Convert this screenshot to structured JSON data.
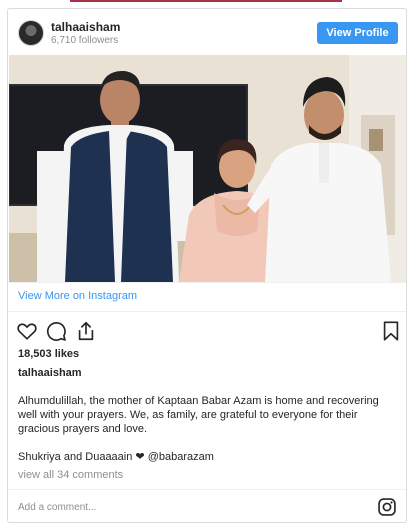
{
  "post": {
    "username": "talhaaisham",
    "followers": "6,710 followers",
    "view_profile": "View Profile",
    "view_more": "View More on Instagram",
    "likes": "18,503 likes",
    "caption_user": "talhaaisham",
    "caption": "Alhumdulillah, the mother of Kaptaan Babar Azam is home and recovering well with your prayers. We, as family, are grateful to everyone for their gracious prayers and love.",
    "caption_line2_text": "Shukriya and Duaaaain",
    "caption_line2_mention": "@babarazam",
    "view_comments": "view all 34 comments",
    "add_comment_placeholder": "Add a comment..."
  },
  "icons": {
    "like": "heart-icon",
    "comment": "comment-icon",
    "share": "share-icon",
    "save": "bookmark-icon",
    "instagram": "instagram-icon",
    "mention_heart": "heart-filled-icon"
  },
  "colors": {
    "link_blue": "#3897f0",
    "button_bg": "#3897f0",
    "muted": "#8e8e8e",
    "text": "#262626",
    "border": "#dbdbdb"
  }
}
